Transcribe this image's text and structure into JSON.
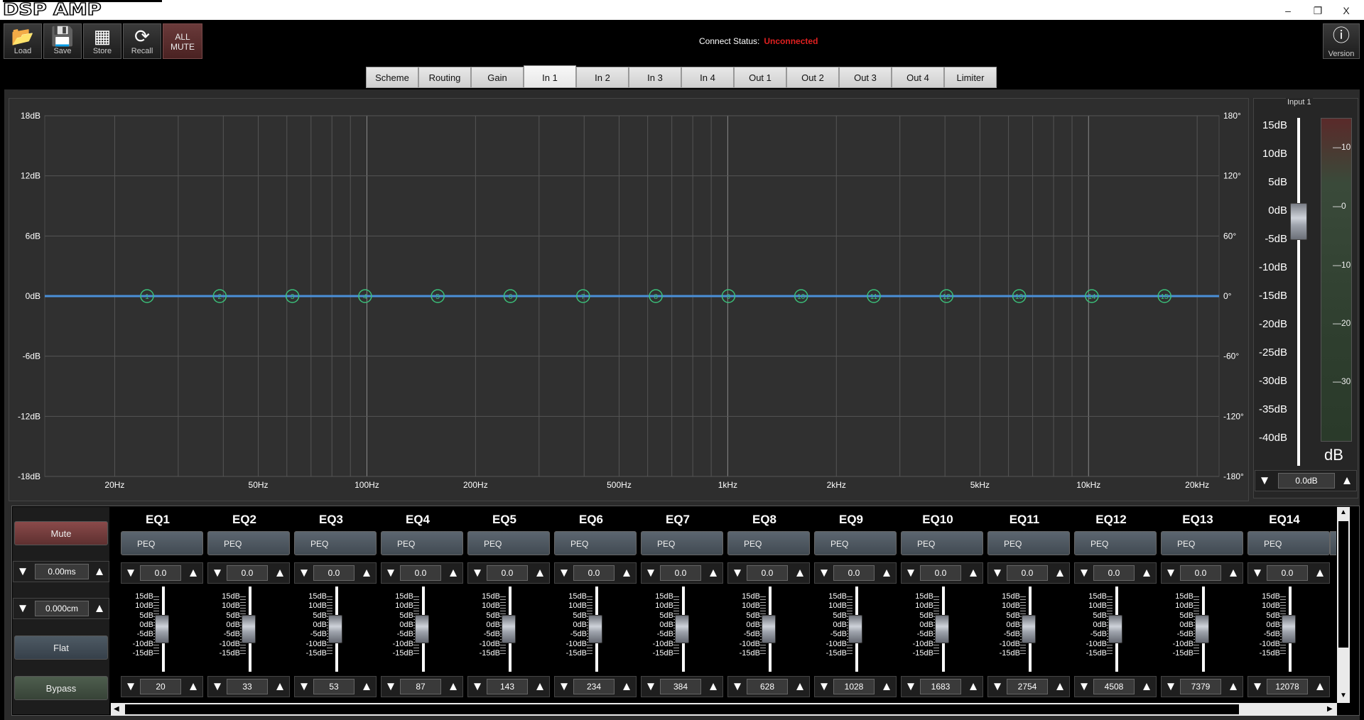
{
  "app": {
    "logo": "DSP AMP"
  },
  "window": {
    "minimize": "–",
    "restore": "❐",
    "close": "X"
  },
  "toolbar": {
    "buttons": [
      {
        "label": "Load",
        "icon": "folder-icon",
        "glyph": "📂"
      },
      {
        "label": "Save",
        "icon": "save-icon",
        "glyph": "💾"
      },
      {
        "label": "Store",
        "icon": "chip-icon",
        "glyph": "▦"
      },
      {
        "label": "Recall",
        "icon": "refresh-icon",
        "glyph": "⟳"
      }
    ],
    "all_mute_line1": "ALL",
    "all_mute_line2": "MUTE",
    "version_label": "Version",
    "version_glyph": "ⓘ"
  },
  "connect": {
    "label": "Connect Status:",
    "value": "Unconnected",
    "value_color": "#e02020"
  },
  "tabs": [
    "Scheme",
    "Routing",
    "Gain",
    "In 1",
    "In 2",
    "In 3",
    "In 4",
    "Out 1",
    "Out 2",
    "Out 3",
    "Out 4",
    "Limiter"
  ],
  "active_tab": "In 1",
  "graph": {
    "left_ticks": [
      "18dB",
      "12dB",
      "6dB",
      "0dB",
      "-6dB",
      "-12dB",
      "-18dB"
    ],
    "right_ticks": [
      "180°",
      "120°",
      "60°",
      "0°",
      "-60°",
      "-120°",
      "-180°"
    ],
    "freq_ticks": [
      "20Hz",
      "50Hz",
      "100Hz",
      "200Hz",
      "500Hz",
      "1kHz",
      "2kHz",
      "5kHz",
      "10kHz",
      "20kHz"
    ],
    "band_markers": [
      "1",
      "2",
      "3",
      "4",
      "5",
      "6",
      "7",
      "8",
      "9",
      "10",
      "11",
      "12",
      "13",
      "14",
      "15"
    ],
    "curve_color": "#4a8fd8",
    "marker_color": "#3bbf7a"
  },
  "input_panel": {
    "legend": "Input 1",
    "scale": [
      "15dB",
      "10dB",
      "5dB",
      "0dB",
      "-5dB",
      "-10dB",
      "-15dB",
      "-20dB",
      "-25dB",
      "-30dB",
      "-35dB",
      "-40dB"
    ],
    "meter_ticks": [
      "10",
      "0",
      "10",
      "20",
      "30"
    ],
    "unit": "dB",
    "gain_value": "0.0dB",
    "gain_level_db": 0
  },
  "left_controls": {
    "mute": "Mute",
    "delay_ms": "0.00ms",
    "delay_cm": "0.000cm",
    "flat": "Flat",
    "bypass": "Bypass"
  },
  "eq_scale": [
    "15dB",
    "10dB",
    "5dB",
    "0dB",
    "-5dB",
    "-10dB",
    "-15dB"
  ],
  "eqs": [
    {
      "name": "EQ1",
      "type": "PEQ",
      "gain": "0.0",
      "freq": "20"
    },
    {
      "name": "EQ2",
      "type": "PEQ",
      "gain": "0.0",
      "freq": "33"
    },
    {
      "name": "EQ3",
      "type": "PEQ",
      "gain": "0.0",
      "freq": "53"
    },
    {
      "name": "EQ4",
      "type": "PEQ",
      "gain": "0.0",
      "freq": "87"
    },
    {
      "name": "EQ5",
      "type": "PEQ",
      "gain": "0.0",
      "freq": "143"
    },
    {
      "name": "EQ6",
      "type": "PEQ",
      "gain": "0.0",
      "freq": "234"
    },
    {
      "name": "EQ7",
      "type": "PEQ",
      "gain": "0.0",
      "freq": "384"
    },
    {
      "name": "EQ8",
      "type": "PEQ",
      "gain": "0.0",
      "freq": "628"
    },
    {
      "name": "EQ9",
      "type": "PEQ",
      "gain": "0.0",
      "freq": "1028"
    },
    {
      "name": "EQ10",
      "type": "PEQ",
      "gain": "0.0",
      "freq": "1683"
    },
    {
      "name": "EQ11",
      "type": "PEQ",
      "gain": "0.0",
      "freq": "2754"
    },
    {
      "name": "EQ12",
      "type": "PEQ",
      "gain": "0.0",
      "freq": "4508"
    },
    {
      "name": "EQ13",
      "type": "PEQ",
      "gain": "0.0",
      "freq": "7379"
    },
    {
      "name": "EQ14",
      "type": "PEQ",
      "gain": "0.0",
      "freq": "12078"
    }
  ]
}
